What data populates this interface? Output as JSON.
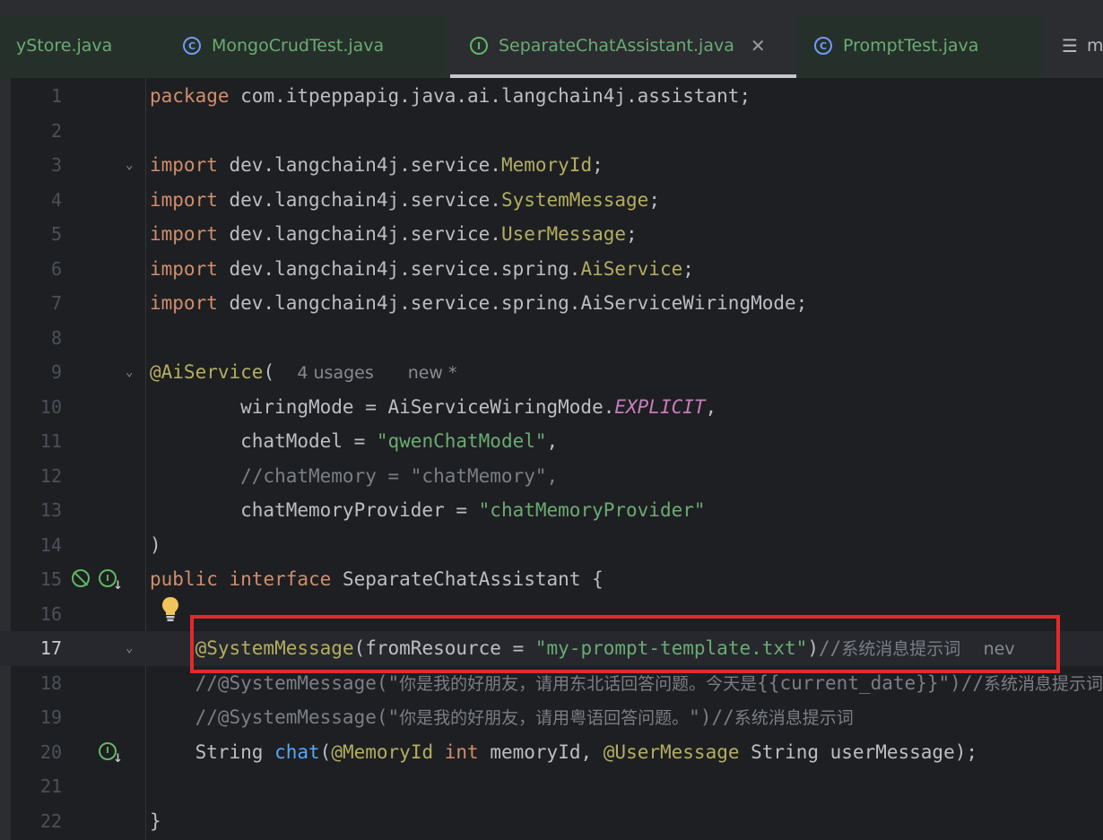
{
  "tabs": [
    {
      "label": "yStore.java",
      "icon": "none"
    },
    {
      "label": "MongoCrudTest.java",
      "icon": "class-icon"
    },
    {
      "label": "SeparateChatAssistant.java",
      "icon": "interface-icon",
      "active": true
    },
    {
      "label": "PromptTest.java",
      "icon": "test-class-icon"
    },
    {
      "label": "m",
      "icon": "list-icon"
    }
  ],
  "editor": {
    "current_line": 17,
    "inlay_hints": {
      "usages": "4 usages",
      "new_star": "new *",
      "new_trunc": "nev"
    },
    "lines": [
      {
        "n": "1"
      },
      {
        "n": "2"
      },
      {
        "n": "3"
      },
      {
        "n": "4"
      },
      {
        "n": "5"
      },
      {
        "n": "6"
      },
      {
        "n": "7"
      },
      {
        "n": "8"
      },
      {
        "n": "9"
      },
      {
        "n": "10"
      },
      {
        "n": "11"
      },
      {
        "n": "12"
      },
      {
        "n": "13"
      },
      {
        "n": "14"
      },
      {
        "n": "15"
      },
      {
        "n": "16"
      },
      {
        "n": "17"
      },
      {
        "n": "18"
      },
      {
        "n": "19"
      },
      {
        "n": "20"
      },
      {
        "n": "21"
      },
      {
        "n": "22"
      }
    ],
    "code": {
      "l1_kw": "package",
      "l1_rest": " com.itpeppapig.java.ai.langchain4j.assistant;",
      "import_kw": "import",
      "pkg_service": " dev.langchain4j.service.",
      "pkg_spring": " dev.langchain4j.service.spring.",
      "l3_cls": "MemoryId",
      "l4_cls": "SystemMessage",
      "l5_cls": "UserMessage",
      "l6_cls": "AiService",
      "l7_rest": "AiServiceWiringMode;",
      "semi": ";",
      "l9_ann": "@AiService",
      "l9_paren": "(",
      "l10_a": "        wiringMode = AiServiceWiringMode.",
      "l10_const": "EXPLICIT",
      "l10_b": ",",
      "l11_a": "        chatModel = ",
      "l11_str": "\"qwenChatModel\"",
      "l11_b": ",",
      "l12_cmt": "        //chatMemory = \"chatMemory\",",
      "l13_a": "        chatMemoryProvider = ",
      "l13_str": "\"chatMemoryProvider\"",
      "l14": ")",
      "l15_kw1": "public",
      "l15_kw2": "interface",
      "l15_rest": " SeparateChatAssistant {",
      "l17_indent": "    ",
      "l17_ann": "@SystemMessage",
      "l17_a": "(fromResource = ",
      "l17_str": "\"my-prompt-template.txt\"",
      "l17_b": ")",
      "l17_cmt": "//",
      "l17_cn": "系统消息提示词",
      "l18_cmt": "    //@SystemMessage(\"",
      "l18_cn": "你是我的好朋友，请用东北话回答问题。今天是",
      "l18_cmt2": "{{current_date}}\")//",
      "l18_cn2": "系统消息提示词",
      "l19_cmt": "    //@SystemMessage(\"",
      "l19_cn": "你是我的好朋友，请用粤语回答问题。",
      "l19_cmt2": "\")//",
      "l19_cn2": "系统消息提示词",
      "l20_a": "    String ",
      "l20_fn": "chat",
      "l20_b": "(",
      "l20_ann1": "@MemoryId",
      "l20_sp": " ",
      "l20_kw": "int",
      "l20_c": " memoryId, ",
      "l20_ann2": "@UserMessage",
      "l20_d": " String userMessage);",
      "l22": "}"
    }
  },
  "colors": {
    "background": "#1e1f22",
    "keyword": "#cf8e6d",
    "annotation": "#b3ae60",
    "string": "#6aab73",
    "comment": "#7a7e85",
    "highlight_box": "#e12a2a"
  }
}
